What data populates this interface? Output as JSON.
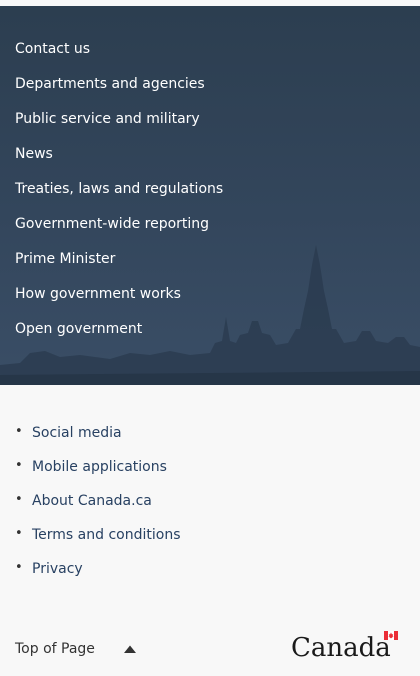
{
  "main_links": [
    "Contact us",
    "Departments and agencies",
    "Public service and military",
    "News",
    "Treaties, laws and regulations",
    "Government-wide reporting",
    "Prime Minister",
    "How government works",
    "Open government"
  ],
  "secondary_links": [
    "Social media",
    "Mobile applications",
    "About Canada.ca",
    "Terms and conditions",
    "Privacy"
  ],
  "top_of_page": "Top of Page",
  "wordmark_text": "Canada",
  "colors": {
    "band": "#33465c",
    "link_secondary": "#284162",
    "flag_red": "#eb2d37"
  },
  "icons": {
    "top_caret": "caret-up-icon",
    "bullet": "bullet-dot"
  }
}
